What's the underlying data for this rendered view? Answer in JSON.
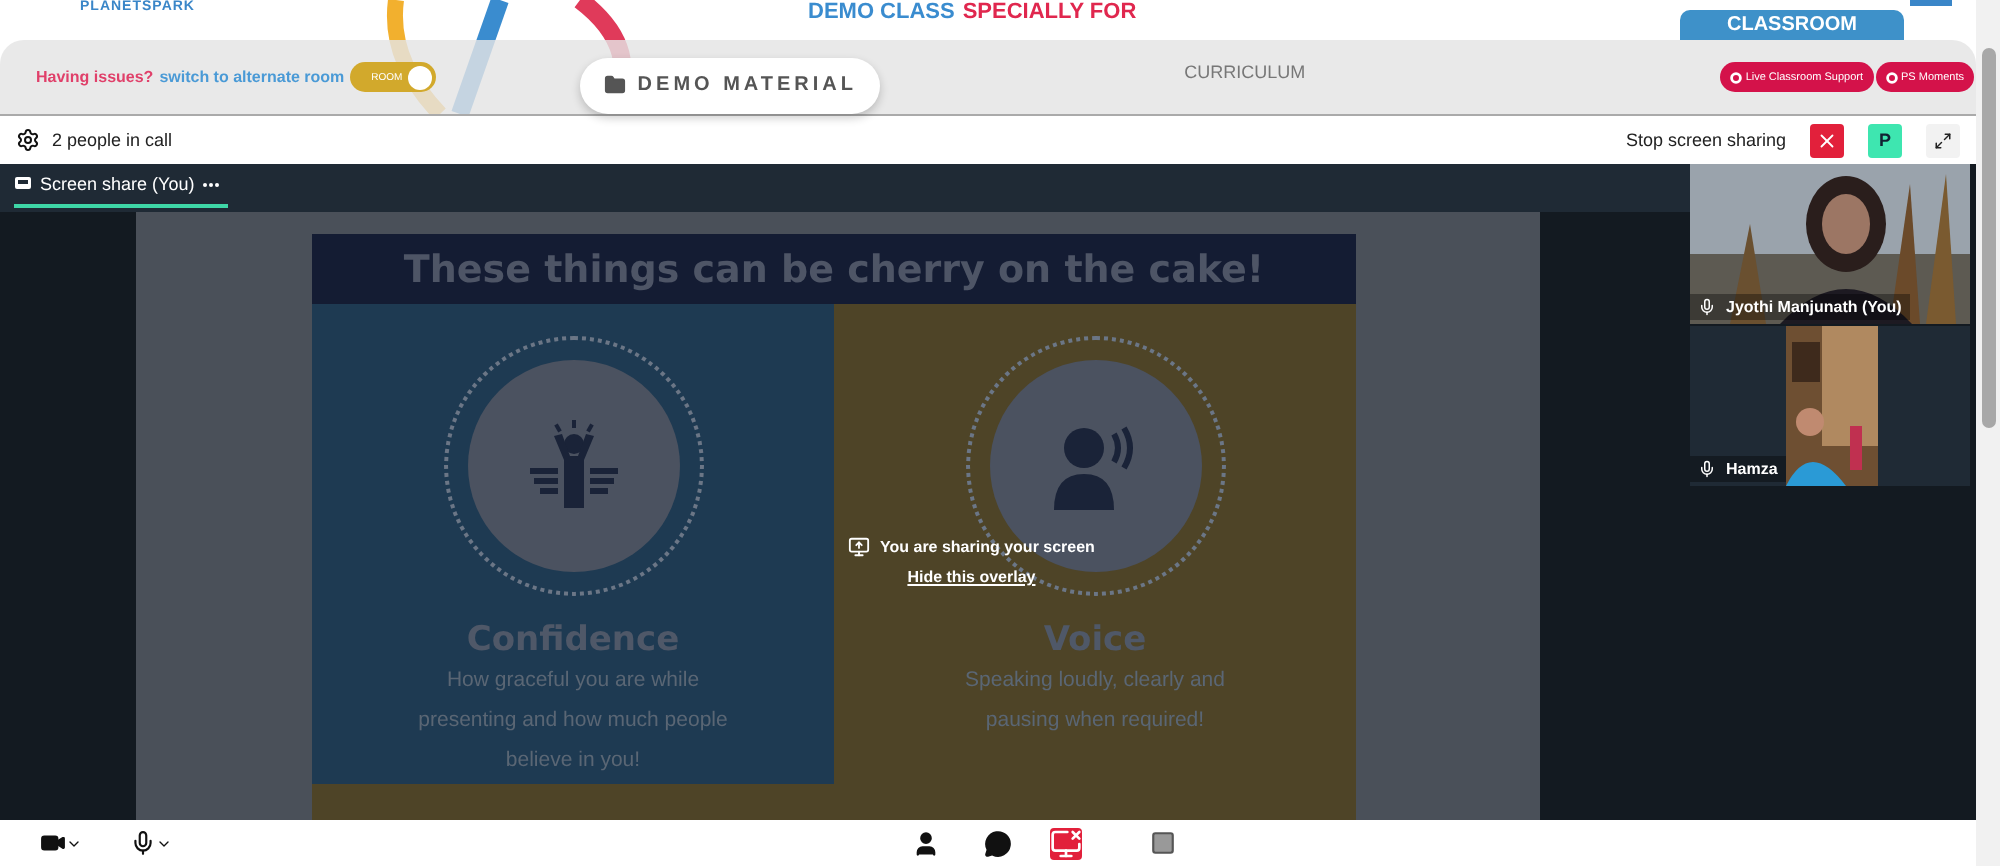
{
  "header": {
    "logo": "PLANETSPARK",
    "title": "DEMO CLASS",
    "title_highlight": "SPECIALLY FOR",
    "tab": "CLASSROOM"
  },
  "notice": {
    "text": "Having issues?",
    "link": "switch to alternate room",
    "toggle": {
      "label": "ROOM",
      "on": true
    }
  },
  "nav": [
    {
      "label": "DEMO MATERIAL",
      "selected": true
    },
    {
      "label": "CURRICULUM",
      "selected": false
    }
  ],
  "actions": [
    "Live Classroom Support",
    "PS Moments"
  ],
  "call": {
    "count": "2 people in call",
    "stop": "Stop screen sharing",
    "avatar": "P"
  },
  "share_tab": {
    "label": "Screen share (You)"
  },
  "slide": {
    "title": "These things can be cherry on the cake!",
    "cards": [
      {
        "kind": "confidence",
        "title": "Confidence",
        "text": "How graceful you are while presenting and how much people believe in you!",
        "color": "#1e3a52"
      },
      {
        "kind": "voice",
        "title": "Voice",
        "text": "Speaking loudly, clearly and pausing when required!",
        "color": "#4e4427"
      }
    ]
  },
  "overlay": {
    "message": "You are sharing your screen",
    "hide": "Hide this overlay"
  },
  "participants": [
    {
      "name": "Jyothi Manjunath (You)"
    },
    {
      "name": "Hamza"
    }
  ]
}
